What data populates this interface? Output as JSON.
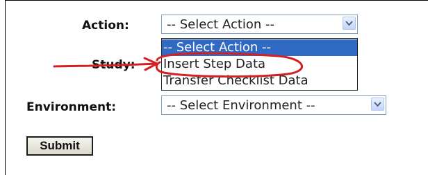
{
  "form": {
    "action_label": "Action:",
    "action_value": "-- Select Action --",
    "study_label": "Study:",
    "environment_label": "Environment:",
    "environment_value": "-- Select Environment --",
    "submit_label": "Submit"
  },
  "action_dropdown": {
    "options": [
      {
        "label": "-- Select Action --",
        "selected": true
      },
      {
        "label": "Insert Step Data",
        "selected": false
      },
      {
        "label": "Transfer Checklist Data",
        "selected": false
      }
    ]
  },
  "annotation": {
    "arrow_color": "#d42020",
    "circle_color": "#d42020",
    "highlight_color": "#316ac5",
    "icon": "red-arrow-icon"
  }
}
